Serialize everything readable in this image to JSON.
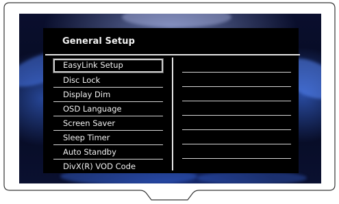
{
  "menu": {
    "title": "General Setup",
    "items": [
      {
        "label": "EasyLink Setup",
        "selected": true
      },
      {
        "label": "Disc Lock",
        "selected": false
      },
      {
        "label": "Display Dim",
        "selected": false
      },
      {
        "label": "OSD Language",
        "selected": false
      },
      {
        "label": "Screen Saver",
        "selected": false
      },
      {
        "label": "Sleep Timer",
        "selected": false
      },
      {
        "label": "Auto Standby",
        "selected": false
      },
      {
        "label": "DivX(R) VOD Code",
        "selected": false
      }
    ],
    "values": [
      "",
      "",
      "",
      "",
      "",
      "",
      ""
    ]
  },
  "colors": {
    "panel": "#000000",
    "text": "#f2f2f2",
    "screen_glow": "#3c6ee6"
  }
}
